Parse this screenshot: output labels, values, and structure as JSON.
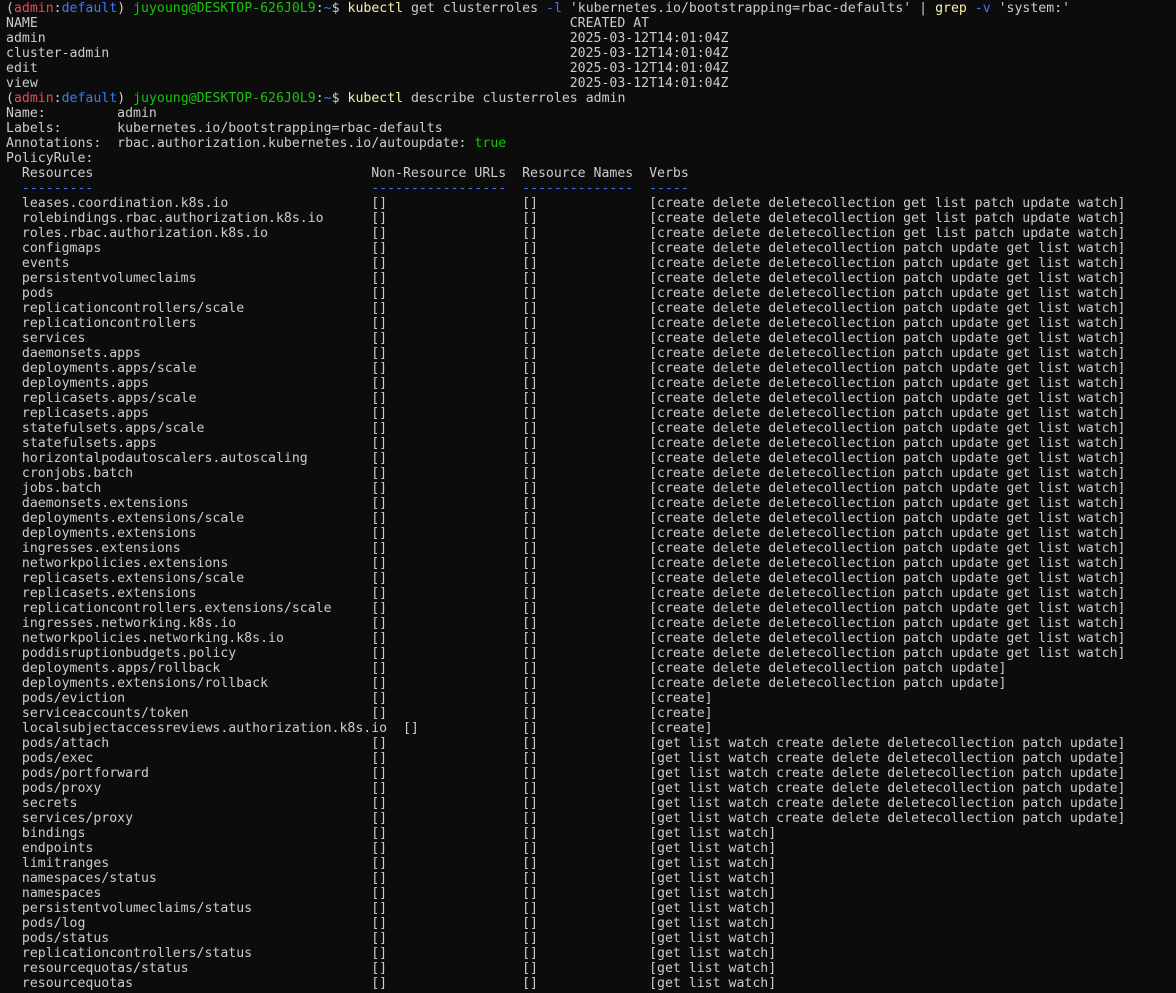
{
  "terminal": {
    "colors": {
      "background": "#0c0c0c",
      "foreground": "#cccccc",
      "context": "#e74856",
      "namespace": "#3b78ff",
      "user_host": "#16c60c",
      "path": "#61d6d6",
      "command": "#f9f1a5",
      "flag": "#3b78ff",
      "true_value": "#16c60c"
    },
    "lines": [
      [
        [
          "(",
          "c-default"
        ],
        [
          "admin",
          "c-red"
        ],
        [
          ":",
          "c-default"
        ],
        [
          "default",
          "c-blue"
        ],
        [
          ") ",
          "c-default"
        ],
        [
          "juyoung@DESKTOP-626J0L9",
          "c-green"
        ],
        [
          ":",
          "c-default"
        ],
        [
          "~",
          "c-blue"
        ],
        [
          "$ ",
          "c-default"
        ],
        [
          "kubectl",
          "c-yellow"
        ],
        [
          " get clusterroles ",
          "c-default"
        ],
        [
          "-l",
          "c-blue"
        ],
        [
          " 'kubernetes.io/bootstrapping=rbac-defaults' | ",
          "c-default"
        ],
        [
          "grep",
          "c-yellow"
        ],
        [
          " ",
          "c-default"
        ],
        [
          "-v",
          "c-blue"
        ],
        [
          " 'system:'",
          "c-default"
        ]
      ],
      [
        [
          "NAME                                                                   CREATED AT",
          "c-default"
        ]
      ],
      [
        [
          "admin                                                                  2025-03-12T14:01:04Z",
          "c-default"
        ]
      ],
      [
        [
          "cluster-admin                                                          2025-03-12T14:01:04Z",
          "c-default"
        ]
      ],
      [
        [
          "edit                                                                   2025-03-12T14:01:04Z",
          "c-default"
        ]
      ],
      [
        [
          "view                                                                   2025-03-12T14:01:04Z",
          "c-default"
        ]
      ],
      [
        [
          "(",
          "c-default"
        ],
        [
          "admin",
          "c-red"
        ],
        [
          ":",
          "c-default"
        ],
        [
          "default",
          "c-blue"
        ],
        [
          ") ",
          "c-default"
        ],
        [
          "juyoung@DESKTOP-626J0L9",
          "c-green"
        ],
        [
          ":",
          "c-default"
        ],
        [
          "~",
          "c-blue"
        ],
        [
          "$ ",
          "c-default"
        ],
        [
          "kubectl",
          "c-yellow"
        ],
        [
          " describe clusterroles admin",
          "c-default"
        ]
      ],
      [
        [
          "Name:         admin",
          "c-default"
        ]
      ],
      [
        [
          "Labels:       kubernetes.io/bootstrapping=rbac-defaults",
          "c-default"
        ]
      ],
      [
        [
          "Annotations:  rbac.authorization.kubernetes.io/autoupdate: ",
          "c-default"
        ],
        [
          "true",
          "c-green"
        ]
      ],
      [
        [
          "PolicyRule:",
          "c-default"
        ]
      ],
      [
        [
          "  Resources                                   Non-Resource URLs  Resource Names  Verbs",
          "c-default"
        ]
      ],
      [
        [
          "  ---------                                   -----------------  --------------  -----",
          "c-blue"
        ]
      ],
      [
        [
          "  leases.coordination.k8s.io                  []                 []              [create delete deletecollection get list patch update watch]",
          "c-default"
        ]
      ],
      [
        [
          "  rolebindings.rbac.authorization.k8s.io      []                 []              [create delete deletecollection get list patch update watch]",
          "c-default"
        ]
      ],
      [
        [
          "  roles.rbac.authorization.k8s.io             []                 []              [create delete deletecollection get list patch update watch]",
          "c-default"
        ]
      ],
      [
        [
          "  configmaps                                  []                 []              [create delete deletecollection patch update get list watch]",
          "c-default"
        ]
      ],
      [
        [
          "  events                                      []                 []              [create delete deletecollection patch update get list watch]",
          "c-default"
        ]
      ],
      [
        [
          "  persistentvolumeclaims                      []                 []              [create delete deletecollection patch update get list watch]",
          "c-default"
        ]
      ],
      [
        [
          "  pods                                        []                 []              [create delete deletecollection patch update get list watch]",
          "c-default"
        ]
      ],
      [
        [
          "  replicationcontrollers/scale                []                 []              [create delete deletecollection patch update get list watch]",
          "c-default"
        ]
      ],
      [
        [
          "  replicationcontrollers                      []                 []              [create delete deletecollection patch update get list watch]",
          "c-default"
        ]
      ],
      [
        [
          "  services                                    []                 []              [create delete deletecollection patch update get list watch]",
          "c-default"
        ]
      ],
      [
        [
          "  daemonsets.apps                             []                 []              [create delete deletecollection patch update get list watch]",
          "c-default"
        ]
      ],
      [
        [
          "  deployments.apps/scale                      []                 []              [create delete deletecollection patch update get list watch]",
          "c-default"
        ]
      ],
      [
        [
          "  deployments.apps                            []                 []              [create delete deletecollection patch update get list watch]",
          "c-default"
        ]
      ],
      [
        [
          "  replicasets.apps/scale                      []                 []              [create delete deletecollection patch update get list watch]",
          "c-default"
        ]
      ],
      [
        [
          "  replicasets.apps                            []                 []              [create delete deletecollection patch update get list watch]",
          "c-default"
        ]
      ],
      [
        [
          "  statefulsets.apps/scale                     []                 []              [create delete deletecollection patch update get list watch]",
          "c-default"
        ]
      ],
      [
        [
          "  statefulsets.apps                           []                 []              [create delete deletecollection patch update get list watch]",
          "c-default"
        ]
      ],
      [
        [
          "  horizontalpodautoscalers.autoscaling        []                 []              [create delete deletecollection patch update get list watch]",
          "c-default"
        ]
      ],
      [
        [
          "  cronjobs.batch                              []                 []              [create delete deletecollection patch update get list watch]",
          "c-default"
        ]
      ],
      [
        [
          "  jobs.batch                                  []                 []              [create delete deletecollection patch update get list watch]",
          "c-default"
        ]
      ],
      [
        [
          "  daemonsets.extensions                       []                 []              [create delete deletecollection patch update get list watch]",
          "c-default"
        ]
      ],
      [
        [
          "  deployments.extensions/scale                []                 []              [create delete deletecollection patch update get list watch]",
          "c-default"
        ]
      ],
      [
        [
          "  deployments.extensions                      []                 []              [create delete deletecollection patch update get list watch]",
          "c-default"
        ]
      ],
      [
        [
          "  ingresses.extensions                        []                 []              [create delete deletecollection patch update get list watch]",
          "c-default"
        ]
      ],
      [
        [
          "  networkpolicies.extensions                  []                 []              [create delete deletecollection patch update get list watch]",
          "c-default"
        ]
      ],
      [
        [
          "  replicasets.extensions/scale                []                 []              [create delete deletecollection patch update get list watch]",
          "c-default"
        ]
      ],
      [
        [
          "  replicasets.extensions                      []                 []              [create delete deletecollection patch update get list watch]",
          "c-default"
        ]
      ],
      [
        [
          "  replicationcontrollers.extensions/scale     []                 []              [create delete deletecollection patch update get list watch]",
          "c-default"
        ]
      ],
      [
        [
          "  ingresses.networking.k8s.io                 []                 []              [create delete deletecollection patch update get list watch]",
          "c-default"
        ]
      ],
      [
        [
          "  networkpolicies.networking.k8s.io           []                 []              [create delete deletecollection patch update get list watch]",
          "c-default"
        ]
      ],
      [
        [
          "  poddisruptionbudgets.policy                 []                 []              [create delete deletecollection patch update get list watch]",
          "c-default"
        ]
      ],
      [
        [
          "  deployments.apps/rollback                   []                 []              [create delete deletecollection patch update]",
          "c-default"
        ]
      ],
      [
        [
          "  deployments.extensions/rollback             []                 []              [create delete deletecollection patch update]",
          "c-default"
        ]
      ],
      [
        [
          "  pods/eviction                               []                 []              [create]",
          "c-default"
        ]
      ],
      [
        [
          "  serviceaccounts/token                       []                 []              [create]",
          "c-default"
        ]
      ],
      [
        [
          "  localsubjectaccessreviews.authorization.k8s.io  []             []              [create]",
          "c-default"
        ]
      ],
      [
        [
          "  pods/attach                                 []                 []              [get list watch create delete deletecollection patch update]",
          "c-default"
        ]
      ],
      [
        [
          "  pods/exec                                   []                 []              [get list watch create delete deletecollection patch update]",
          "c-default"
        ]
      ],
      [
        [
          "  pods/portforward                            []                 []              [get list watch create delete deletecollection patch update]",
          "c-default"
        ]
      ],
      [
        [
          "  pods/proxy                                  []                 []              [get list watch create delete deletecollection patch update]",
          "c-default"
        ]
      ],
      [
        [
          "  secrets                                     []                 []              [get list watch create delete deletecollection patch update]",
          "c-default"
        ]
      ],
      [
        [
          "  services/proxy                              []                 []              [get list watch create delete deletecollection patch update]",
          "c-default"
        ]
      ],
      [
        [
          "  bindings                                    []                 []              [get list watch]",
          "c-default"
        ]
      ],
      [
        [
          "  endpoints                                   []                 []              [get list watch]",
          "c-default"
        ]
      ],
      [
        [
          "  limitranges                                 []                 []              [get list watch]",
          "c-default"
        ]
      ],
      [
        [
          "  namespaces/status                           []                 []              [get list watch]",
          "c-default"
        ]
      ],
      [
        [
          "  namespaces                                  []                 []              [get list watch]",
          "c-default"
        ]
      ],
      [
        [
          "  persistentvolumeclaims/status               []                 []              [get list watch]",
          "c-default"
        ]
      ],
      [
        [
          "  pods/log                                    []                 []              [get list watch]",
          "c-default"
        ]
      ],
      [
        [
          "  pods/status                                 []                 []              [get list watch]",
          "c-default"
        ]
      ],
      [
        [
          "  replicationcontrollers/status               []                 []              [get list watch]",
          "c-default"
        ]
      ],
      [
        [
          "  resourcequotas/status                       []                 []              [get list watch]",
          "c-default"
        ]
      ],
      [
        [
          "  resourcequotas                              []                 []              [get list watch]",
          "c-default"
        ]
      ]
    ]
  }
}
